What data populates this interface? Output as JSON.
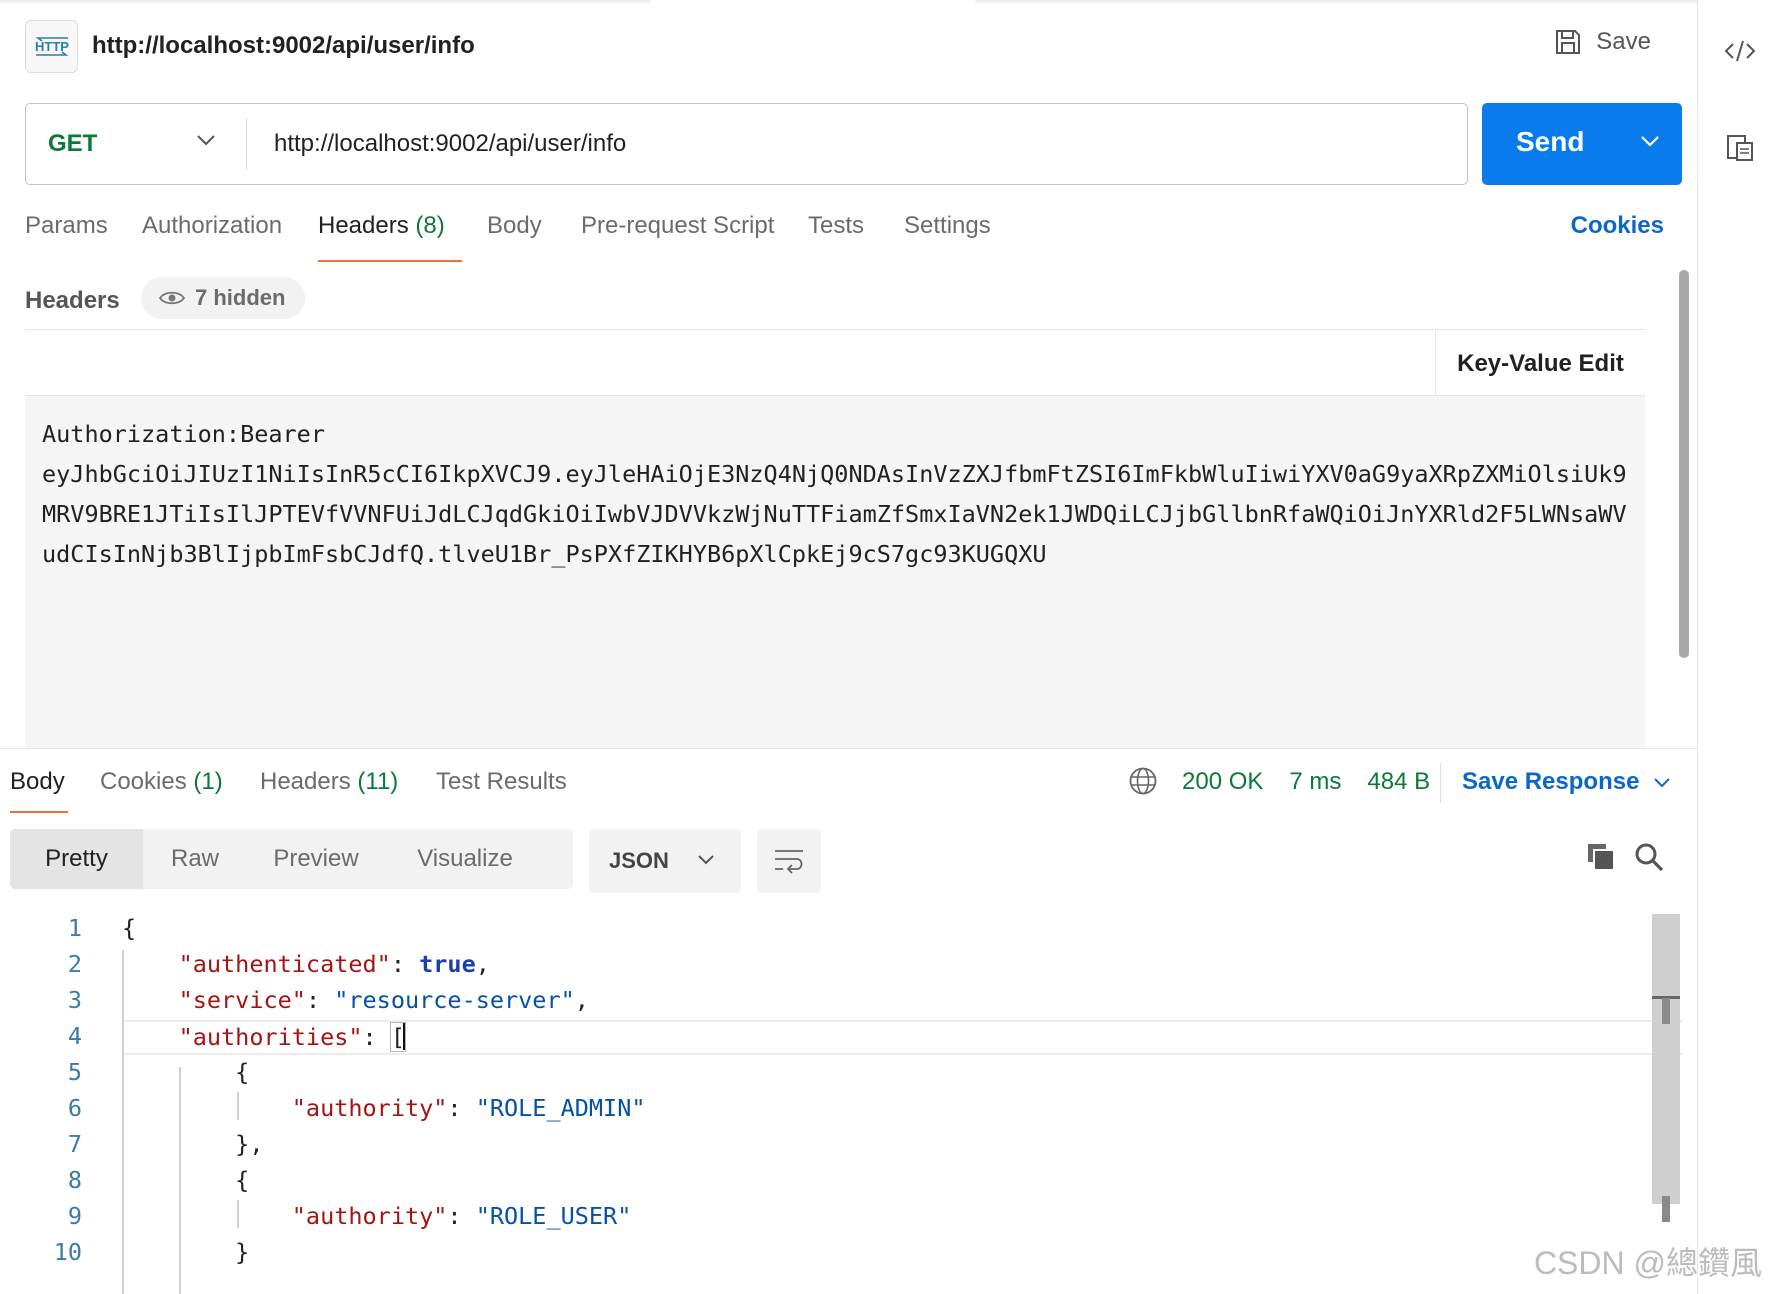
{
  "request": {
    "title": "http://localhost:9002/api/user/info",
    "badge": "HTTP",
    "save_label": "Save",
    "method": "GET",
    "url": "http://localhost:9002/api/user/info",
    "send_label": "Send"
  },
  "request_tabs": [
    {
      "label": "Params",
      "count": ""
    },
    {
      "label": "Authorization",
      "count": ""
    },
    {
      "label": "Headers",
      "count": "(8)"
    },
    {
      "label": "Body",
      "count": ""
    },
    {
      "label": "Pre-request Script",
      "count": ""
    },
    {
      "label": "Tests",
      "count": ""
    },
    {
      "label": "Settings",
      "count": ""
    }
  ],
  "cookies_label": "Cookies",
  "headers_section": {
    "label": "Headers",
    "hidden_label": "7 hidden",
    "kv_edit_label": "Key-Value Edit",
    "bulk_text": "Authorization:Bearer\neyJhbGciOiJIUzI1NiIsInR5cCI6IkpXVCJ9.eyJleHAiOjE3NzQ4NjQ0NDAsInVzZXJfbmFtZSI6ImFkbWluIiwiYXV0aG9yaXRpZXMiOlsiUk9MRV9BRE1JTiIsIlJPTEVfVVNFUiJdLCJqdGkiOiIwbVJDVVkzWjNuTTFiamZfSmxIaVN2ek1JWDQiLCJjbGllbnRfaWQiOiJnYXRld2F5LWNsaWVudCIsInNjb3BlIjpbImFsbCJdfQ.tlveU1Br_PsPXfZIKHYB6pXlCpkEj9cS7gc93KUGQXU"
  },
  "response": {
    "tabs": [
      {
        "label": "Body",
        "count": ""
      },
      {
        "label": "Cookies",
        "count": "(1)"
      },
      {
        "label": "Headers",
        "count": "(11)"
      },
      {
        "label": "Test Results",
        "count": ""
      }
    ],
    "status": "200 OK",
    "time": "7 ms",
    "size": "484 B",
    "save_response_label": "Save Response",
    "view_modes": [
      "Pretty",
      "Raw",
      "Preview",
      "Visualize"
    ],
    "format": "JSON",
    "line_numbers": [
      "1",
      "2",
      "3",
      "4",
      "5",
      "6",
      "7",
      "8",
      "9",
      "10"
    ],
    "code": {
      "open_brace": "{",
      "k_authenticated": "\"authenticated\"",
      "v_authenticated": "true",
      "k_service": "\"service\"",
      "v_service": "\"resource-server\"",
      "k_authorities": "\"authorities\"",
      "open_bracket": "[",
      "k_authority": "\"authority\"",
      "v_admin": "\"ROLE_ADMIN\"",
      "v_user": "\"ROLE_USER\""
    }
  },
  "watermark": "CSDN @總鑽風",
  "colors": {
    "accent": "#097bed",
    "method": "#0b7a38",
    "tab_underline": "#f26b3a",
    "link": "#0b68c9"
  }
}
